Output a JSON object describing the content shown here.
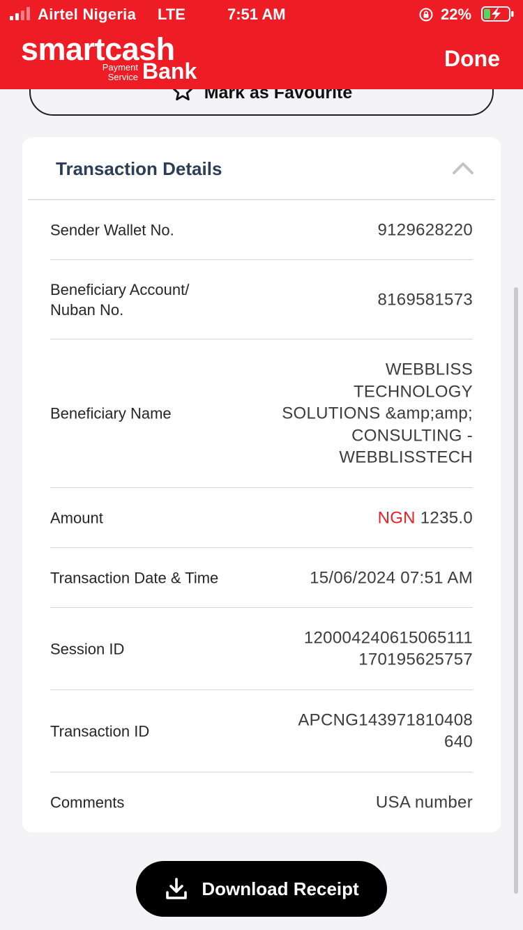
{
  "status_bar": {
    "carrier": "Airtel Nigeria",
    "network": "LTE",
    "time": "7:51 AM",
    "battery_percent": "22%"
  },
  "header": {
    "logo_main": "smartcash",
    "logo_sub_line1": "Payment",
    "logo_sub_line2": "Service",
    "logo_bank": "Bank",
    "done_label": "Done",
    "background_color": "#ee1c25"
  },
  "favourite": {
    "label": "Mark as Favourite",
    "icon": "star-icon"
  },
  "details": {
    "title": "Transaction Details",
    "collapse_icon": "chevron-up-icon",
    "rows": [
      {
        "label": "Sender Wallet No.",
        "value": "9129628220"
      },
      {
        "label": "Beneficiary Account/ Nuban No.",
        "label_line1": "Beneficiary Account/",
        "label_line2": "Nuban No.",
        "value": "8169581573"
      },
      {
        "label": "Beneficiary Name",
        "value_lines": [
          "WEBBLISS",
          "TECHNOLOGY",
          "SOLUTIONS &amp;amp;",
          "CONSULTING -",
          "WEBBLISSTECH"
        ]
      },
      {
        "label": "Amount",
        "currency": "NGN",
        "amount": "1235.0"
      },
      {
        "label": "Transaction Date & Time",
        "value": "15/06/2024 07:51 AM"
      },
      {
        "label": "Session ID",
        "value_lines": [
          "120004240615065111",
          "170195625757"
        ]
      },
      {
        "label": "Transaction ID",
        "value_lines": [
          "APCNG143971810408",
          "640"
        ]
      },
      {
        "label": "Comments",
        "value": "USA number"
      }
    ]
  },
  "download": {
    "label": "Download Receipt",
    "icon": "download-icon"
  },
  "colors": {
    "accent_red": "#ee1c25",
    "title_navy": "#2c3e55"
  }
}
